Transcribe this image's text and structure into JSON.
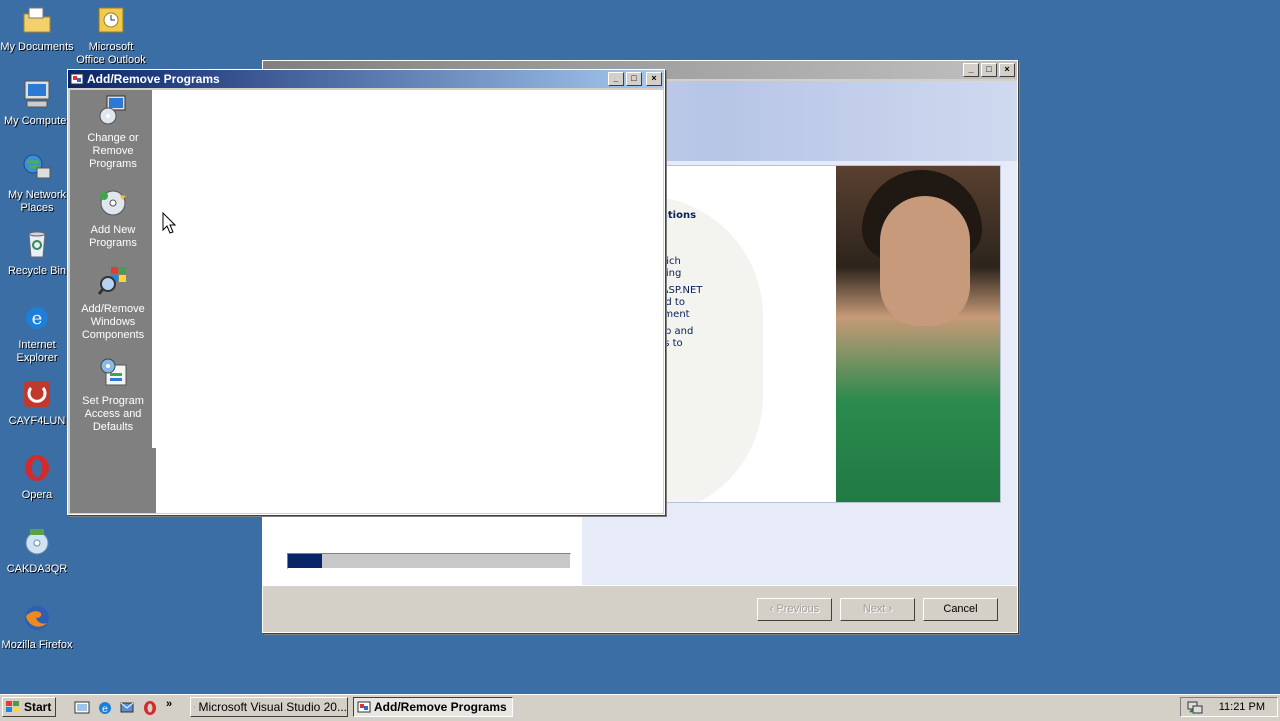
{
  "desktop": {
    "icons": [
      {
        "label": "My Documents",
        "icon": "my-documents-icon"
      },
      {
        "label": "Microsoft Office Outlook",
        "icon": "outlook-icon"
      },
      {
        "label": "My Computer",
        "icon": "my-computer-icon"
      },
      {
        "label": "My Network Places",
        "icon": "network-places-icon"
      },
      {
        "label": "Recycle Bin",
        "icon": "recycle-bin-icon"
      },
      {
        "label": "Internet Explorer",
        "icon": "internet-explorer-icon"
      },
      {
        "label": "CAYF4LUN",
        "icon": "app-icon"
      },
      {
        "label": "Opera",
        "icon": "opera-icon"
      },
      {
        "label": "CAKDA3QR",
        "icon": "disc-icon"
      },
      {
        "label": "Mozilla Firefox",
        "icon": "firefox-icon"
      }
    ]
  },
  "setup_window": {
    "banner": {
      "heading": "er Web Applications\nNET 2.0",
      "paragraphs": [
        "ode faster with a\nul new editor which\nes HTML formatting",
        "er over 50 new ASP.NET\ncontrols designed to\nate site development",
        "ilt-in membership and\nalization services to\ne your site"
      ]
    },
    "progress_fraction": 0.12,
    "buttons": {
      "previous": "‹ Previous",
      "next": "Next ›",
      "cancel": "Cancel"
    }
  },
  "arp_window": {
    "title": "Add/Remove Programs",
    "sidebar": [
      {
        "label": "Change or Remove Programs",
        "icon": "change-remove-programs-icon"
      },
      {
        "label": "Add New Programs",
        "icon": "add-new-programs-icon"
      },
      {
        "label": "Add/Remove Windows Components",
        "icon": "windows-components-icon"
      },
      {
        "label": "Set Program Access and Defaults",
        "icon": "program-defaults-icon"
      }
    ]
  },
  "taskbar": {
    "start_label": "Start",
    "tasks": [
      {
        "label": "Microsoft Visual Studio 20...",
        "active": false
      },
      {
        "label": "Add/Remove Programs",
        "active": true
      }
    ],
    "clock": "11:21 PM"
  },
  "colors": {
    "desktop": "#3a6ea5",
    "title_active": "#0a246a",
    "progress": "#0a246a"
  }
}
